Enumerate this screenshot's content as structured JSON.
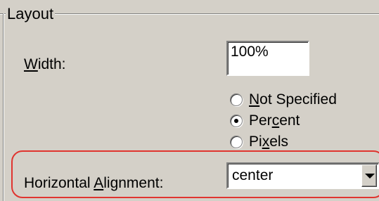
{
  "group": {
    "title": "Layout"
  },
  "width": {
    "label_access_key": "W",
    "label_rest": "idth:",
    "value": "100%"
  },
  "width_unit": {
    "options": [
      {
        "access_key": "N",
        "rest": "ot Specified",
        "before": "",
        "checked": false
      },
      {
        "before": "Per",
        "access_key": "c",
        "rest": "ent",
        "checked": true
      },
      {
        "before": "Pi",
        "access_key": "x",
        "rest": "els",
        "checked": false
      }
    ]
  },
  "horizontal_alignment": {
    "label_before": "Horizontal ",
    "label_access_key": "A",
    "label_rest": "lignment:",
    "value": "center"
  },
  "icons": {
    "dropdown": "chevron-down-icon"
  },
  "colors": {
    "highlight": "#e0342f",
    "dialog_background": "#d4d0c8"
  }
}
